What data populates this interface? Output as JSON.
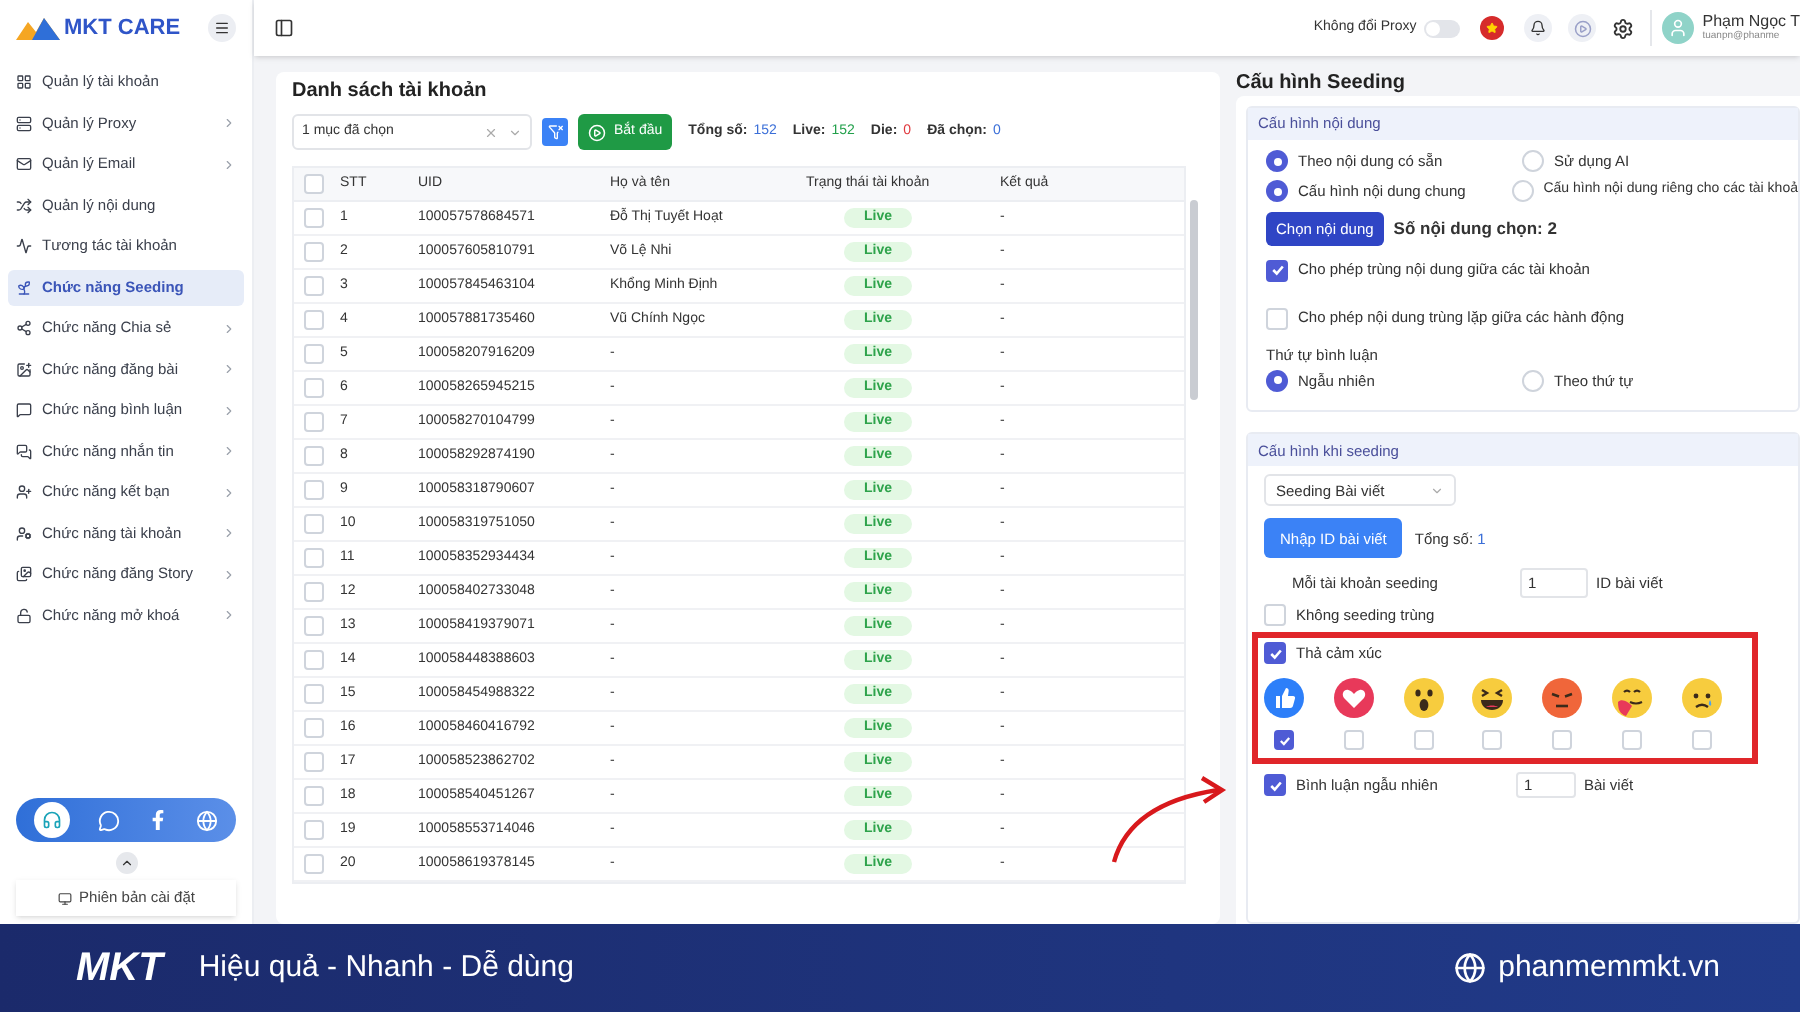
{
  "logo": {
    "text": "MKT CARE"
  },
  "sidebar": {
    "items": [
      {
        "label": "Quản lý tài khoản",
        "has_submenu": false,
        "selected": false
      },
      {
        "label": "Quản lý Proxy",
        "has_submenu": true,
        "selected": false
      },
      {
        "label": "Quản lý Email",
        "has_submenu": true,
        "selected": false
      },
      {
        "label": "Quản lý nội dung",
        "has_submenu": false,
        "selected": false
      },
      {
        "label": "Tương tác tài khoản",
        "has_submenu": false,
        "selected": false
      },
      {
        "label": "Chức năng Seeding",
        "has_submenu": false,
        "selected": true
      },
      {
        "label": "Chức năng Chia sẻ",
        "has_submenu": true,
        "selected": false
      },
      {
        "label": "Chức năng đăng bài",
        "has_submenu": true,
        "selected": false
      },
      {
        "label": "Chức năng bình luận",
        "has_submenu": true,
        "selected": false
      },
      {
        "label": "Chức năng nhắn tin",
        "has_submenu": true,
        "selected": false
      },
      {
        "label": "Chức năng kết bạn",
        "has_submenu": true,
        "selected": false
      },
      {
        "label": "Chức năng tài khoản",
        "has_submenu": true,
        "selected": false
      },
      {
        "label": "Chức năng đăng Story",
        "has_submenu": true,
        "selected": false
      },
      {
        "label": "Chức năng mở khoá",
        "has_submenu": true,
        "selected": false
      }
    ],
    "version_button": "Phiên bản cài đặt"
  },
  "topbar": {
    "proxy_label": "Không đổi Proxy",
    "proxy_on": false,
    "user_name": "Phạm Ngọc T",
    "user_email": "tuanpn@phanme"
  },
  "accounts": {
    "title": "Danh sách tài khoản",
    "select_value": "1 mục đã chọn",
    "start_button": "Bắt đầu",
    "stats": [
      {
        "label": "Tổng số:",
        "value": "152",
        "color": "#3b6fd8"
      },
      {
        "label": "Live:",
        "value": "152",
        "color": "#22a04b"
      },
      {
        "label": "Die:",
        "value": "0",
        "color": "#e0393e"
      },
      {
        "label": "Đã chọn:",
        "value": "0",
        "color": "#3b6fd8"
      }
    ],
    "all_checked": false,
    "columns": [
      "STT",
      "UID",
      "Họ và tên",
      "Trạng thái tài khoản",
      "Kết quả"
    ],
    "rows": [
      {
        "stt": "1",
        "uid": "100057578684571",
        "name": "Đỗ Thị Tuyết Hoạt",
        "status": "Live",
        "result": "-",
        "checked": false
      },
      {
        "stt": "2",
        "uid": "100057605810791",
        "name": "Võ Lệ Nhi",
        "status": "Live",
        "result": "-",
        "checked": false
      },
      {
        "stt": "3",
        "uid": "100057845463104",
        "name": "Khổng Minh Định",
        "status": "Live",
        "result": "-",
        "checked": false
      },
      {
        "stt": "4",
        "uid": "100057881735460",
        "name": "Vũ Chính Ngọc",
        "status": "Live",
        "result": "-",
        "checked": false
      },
      {
        "stt": "5",
        "uid": "100058207916209",
        "name": "-",
        "status": "Live",
        "result": "-",
        "checked": false
      },
      {
        "stt": "6",
        "uid": "100058265945215",
        "name": "-",
        "status": "Live",
        "result": "-",
        "checked": false
      },
      {
        "stt": "7",
        "uid": "100058270104799",
        "name": "-",
        "status": "Live",
        "result": "-",
        "checked": false
      },
      {
        "stt": "8",
        "uid": "100058292874190",
        "name": "-",
        "status": "Live",
        "result": "-",
        "checked": false
      },
      {
        "stt": "9",
        "uid": "100058318790607",
        "name": "-",
        "status": "Live",
        "result": "-",
        "checked": false
      },
      {
        "stt": "10",
        "uid": "100058319751050",
        "name": "-",
        "status": "Live",
        "result": "-",
        "checked": false
      },
      {
        "stt": "11",
        "uid": "100058352934434",
        "name": "-",
        "status": "Live",
        "result": "-",
        "checked": false
      },
      {
        "stt": "12",
        "uid": "100058402733048",
        "name": "-",
        "status": "Live",
        "result": "-",
        "checked": false
      },
      {
        "stt": "13",
        "uid": "100058419379071",
        "name": "-",
        "status": "Live",
        "result": "-",
        "checked": false
      },
      {
        "stt": "14",
        "uid": "100058448388603",
        "name": "-",
        "status": "Live",
        "result": "-",
        "checked": false
      },
      {
        "stt": "15",
        "uid": "100058454988322",
        "name": "-",
        "status": "Live",
        "result": "-",
        "checked": false
      },
      {
        "stt": "16",
        "uid": "100058460416792",
        "name": "-",
        "status": "Live",
        "result": "-",
        "checked": false
      },
      {
        "stt": "17",
        "uid": "100058523862702",
        "name": "-",
        "status": "Live",
        "result": "-",
        "checked": false
      },
      {
        "stt": "18",
        "uid": "100058540451267",
        "name": "-",
        "status": "Live",
        "result": "-",
        "checked": false
      },
      {
        "stt": "19",
        "uid": "100058553714046",
        "name": "-",
        "status": "Live",
        "result": "-",
        "checked": false
      },
      {
        "stt": "20",
        "uid": "100058619378145",
        "name": "-",
        "status": "Live",
        "result": "-",
        "checked": false
      }
    ]
  },
  "seeding": {
    "title": "Cấu hình Seeding",
    "content_section": {
      "title": "Cấu hình nội dung",
      "source_options": [
        {
          "label": "Theo nội dung có sẵn",
          "selected": true
        },
        {
          "label": "Sử dụng AI",
          "selected": false
        }
      ],
      "scope_options": [
        {
          "label": "Cấu hình nội dung chung",
          "selected": true
        },
        {
          "label": "Cấu hình nội dung riêng cho các tài khoả",
          "selected": false
        }
      ],
      "choose_button": "Chọn nội dung",
      "chosen_count": "Số nội dung chọn: 2",
      "checkboxes": [
        {
          "label": "Cho phép trùng nội dung giữa các tài khoản",
          "checked": true
        },
        {
          "label": "Cho phép nội dung trùng lặp giữa các hành động",
          "checked": false
        }
      ],
      "order_label": "Thứ tự bình luận",
      "order_options": [
        {
          "label": "Ngẫu nhiên",
          "selected": true
        },
        {
          "label": "Theo thứ tự",
          "selected": false
        }
      ]
    },
    "run_section": {
      "title": "Cấu hình khi seeding",
      "type_select": "Seeding Bài viết",
      "import_button": "Nhập ID bài viết",
      "total_label": "Tổng số:",
      "total_value": "1",
      "per_account_label": "Mỗi tài khoản seeding",
      "per_account_value": "1",
      "per_account_unit": "ID bài viết",
      "no_duplicate": {
        "label": "Không seeding trùng",
        "checked": false
      },
      "react": {
        "label": "Thả cảm xúc",
        "checked": true
      },
      "reactions": [
        {
          "kind": "like",
          "checked": true
        },
        {
          "kind": "love",
          "checked": false
        },
        {
          "kind": "wow",
          "checked": false
        },
        {
          "kind": "haha",
          "checked": false
        },
        {
          "kind": "angry",
          "checked": false
        },
        {
          "kind": "care",
          "checked": false
        },
        {
          "kind": "sad",
          "checked": false
        }
      ],
      "random_comment": {
        "label": "Bình luận ngẫu nhiên",
        "checked": true,
        "value": "1",
        "unit": "Bài viết"
      }
    }
  },
  "banner": {
    "logo": "MKT",
    "slogan": "Hiệu quả - Nhanh - Dễ dùng",
    "website": "phanmemmkt.vn"
  }
}
